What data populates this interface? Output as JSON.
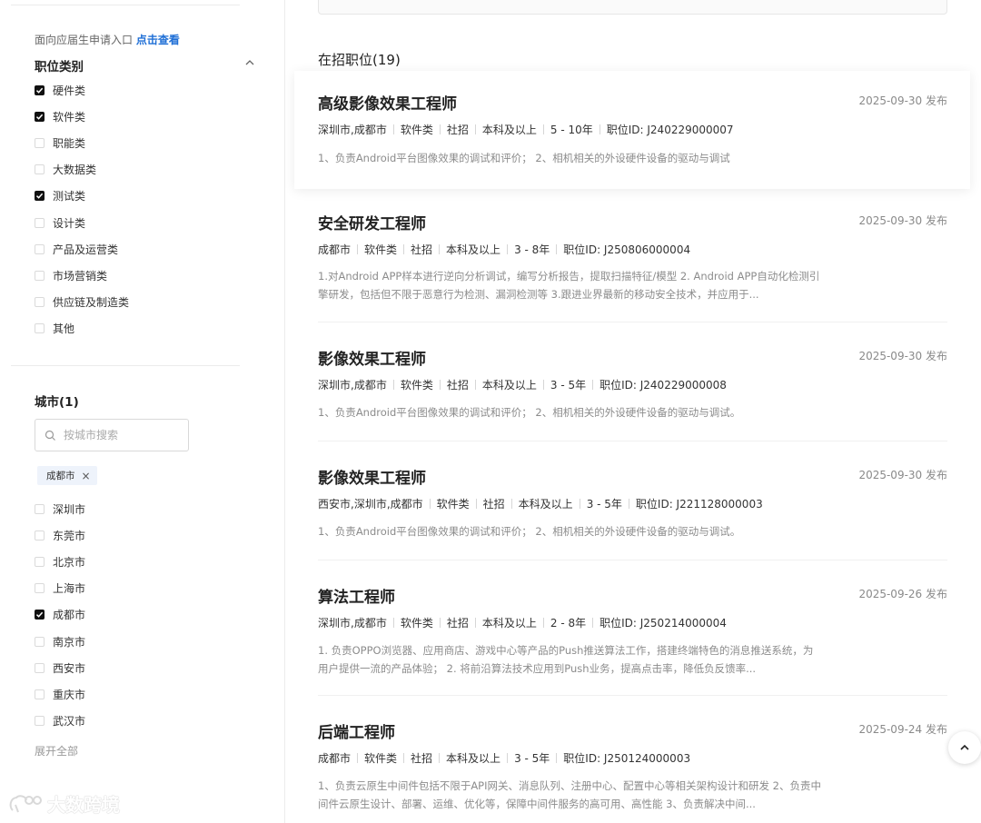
{
  "sidebar": {
    "applicant_text": "面向应届生申请入口",
    "applicant_link": "点击查看",
    "category": {
      "title": "职位类别",
      "items": [
        {
          "label": "硬件类",
          "checked": true
        },
        {
          "label": "软件类",
          "checked": true
        },
        {
          "label": "职能类",
          "checked": false
        },
        {
          "label": "大数据类",
          "checked": false
        },
        {
          "label": "测试类",
          "checked": true
        },
        {
          "label": "设计类",
          "checked": false
        },
        {
          "label": "产品及运营类",
          "checked": false
        },
        {
          "label": "市场营销类",
          "checked": false
        },
        {
          "label": "供应链及制造类",
          "checked": false
        },
        {
          "label": "其他",
          "checked": false
        }
      ]
    },
    "city": {
      "title": "城市(1)",
      "search_placeholder": "按城市搜索",
      "selected_tag": "成都市",
      "tag_close": "×",
      "items": [
        {
          "label": "深圳市",
          "checked": false
        },
        {
          "label": "东莞市",
          "checked": false
        },
        {
          "label": "北京市",
          "checked": false
        },
        {
          "label": "上海市",
          "checked": false
        },
        {
          "label": "成都市",
          "checked": true
        },
        {
          "label": "南京市",
          "checked": false
        },
        {
          "label": "西安市",
          "checked": false
        },
        {
          "label": "重庆市",
          "checked": false
        },
        {
          "label": "武汉市",
          "checked": false
        }
      ],
      "expand_all": "展开全部"
    },
    "watermark": "大数跨境"
  },
  "main": {
    "count_title": "在招职位(19)",
    "jobs": [
      {
        "title": "高级影像效果工程师",
        "date": "2025-09-30 发布",
        "meta": [
          "深圳市,成都市",
          "软件类",
          "社招",
          "本科及以上",
          "5 - 10年",
          "职位ID:  J240229000007"
        ],
        "desc": "1、负责Android平台图像效果的调试和评价；  2、相机相关的外设硬件设备的驱动与调试"
      },
      {
        "title": "安全研发工程师",
        "date": "2025-09-30 发布",
        "meta": [
          "成都市",
          "软件类",
          "社招",
          "本科及以上",
          "3 - 8年",
          "职位ID:  J250806000004"
        ],
        "desc": "1.对Android APP样本进行逆向分析调试，编写分析报告，提取扫描特征/模型 2. Android APP自动化检测引擎研发，包括但不限于恶意行为检测、漏洞检测等 3.跟进业界最新的移动安全技术，并应用于..."
      },
      {
        "title": "影像效果工程师",
        "date": "2025-09-30 发布",
        "meta": [
          "深圳市,成都市",
          "软件类",
          "社招",
          "本科及以上",
          "3 - 5年",
          "职位ID:  J240229000008"
        ],
        "desc": "1、负责Android平台图像效果的调试和评价；  2、相机相关的外设硬件设备的驱动与调试。"
      },
      {
        "title": "影像效果工程师",
        "date": "2025-09-30 发布",
        "meta": [
          "西安市,深圳市,成都市",
          "软件类",
          "社招",
          "本科及以上",
          "3 - 5年",
          "职位ID:  J221128000003"
        ],
        "desc": "1、负责Android平台图像效果的调试和评价；  2、相机相关的外设硬件设备的驱动与调试。"
      },
      {
        "title": "算法工程师",
        "date": "2025-09-26 发布",
        "meta": [
          "深圳市,成都市",
          "软件类",
          "社招",
          "本科及以上",
          "2 - 8年",
          "职位ID:  J250214000004"
        ],
        "desc": "1. 负责OPPO浏览器、应用商店、游戏中心等产品的Push推送算法工作，搭建终端特色的消息推送系统，为用户提供一流的产品体验；  2. 将前沿算法技术应用到Push业务，提高点击率，降低负反馈率..."
      },
      {
        "title": "后端工程师",
        "date": "2025-09-24 发布",
        "meta": [
          "成都市",
          "软件类",
          "社招",
          "本科及以上",
          "3 - 5年",
          "职位ID:  J250124000003"
        ],
        "desc": "1、负责云原生中间件包括不限于API网关、消息队列、注册中心、配置中心等相关架构设计和研发 2、负责中间件云原生设计、部署、运维、优化等，保障中间件服务的高可用、高性能 3、负责解决中间..."
      }
    ]
  },
  "icons": {
    "chevron": "chevron-up-icon",
    "search": "search-icon",
    "scroll_top": "arrow-up-icon",
    "check": "check-icon"
  }
}
